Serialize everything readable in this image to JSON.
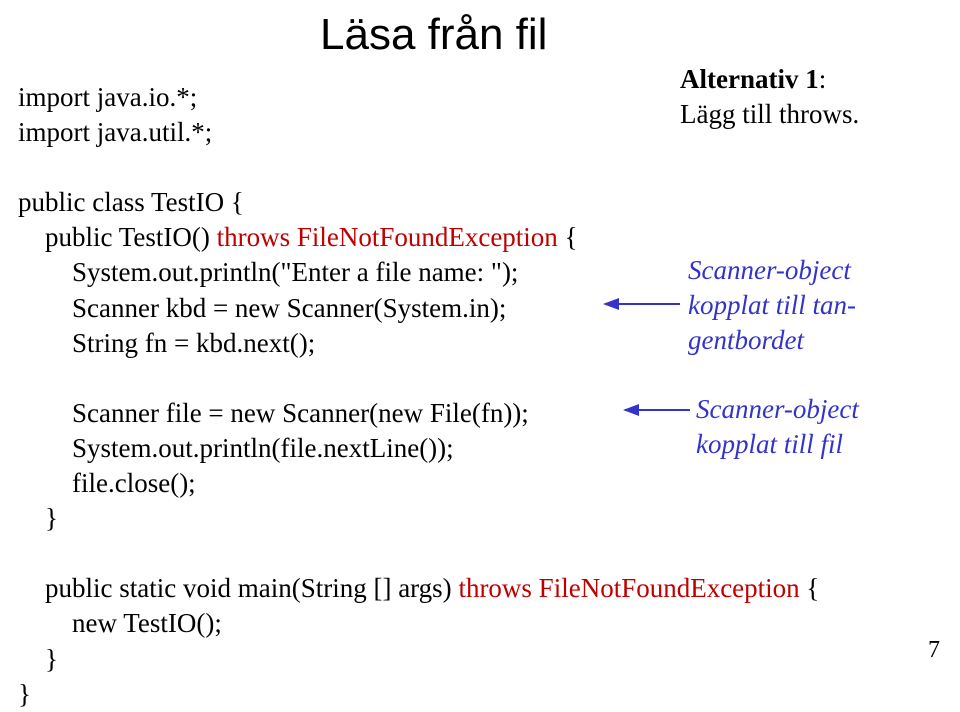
{
  "title": "Läsa från fil",
  "code": {
    "import1": "import java.io.*;",
    "import2": "import java.util.*;",
    "classDecl": "public class TestIO {",
    "ctorDecl_pre": "    public TestIO() ",
    "ctorDecl_throws": "throws FileNotFoundException",
    "ctorDecl_post": " {",
    "l1": "        System.out.println(\"Enter a file name: \");",
    "l2": "        Scanner kbd = new Scanner(System.in);",
    "l3": "        String fn = kbd.next();",
    "l4": "        Scanner file = new Scanner(new File(fn));",
    "l5": "        System.out.println(file.nextLine());",
    "l6": "        file.close();",
    "l7": "    }",
    "main_pre": "    public static void main(String [] args) ",
    "main_throws": "throws FileNotFoundException",
    "main_post": " {",
    "main_body": "        new TestIO();",
    "main_close": "    }",
    "class_close": "}"
  },
  "ann": {
    "alt1a": "Alternativ 1",
    "alt1b": "Lägg till throws.",
    "kbd1": "Scanner-object",
    "kbd2": "kopplat till tan-",
    "kbd3": "gentbordet",
    "file1": "Scanner-object",
    "file2": "kopplat till fil"
  },
  "pageNum": "7"
}
